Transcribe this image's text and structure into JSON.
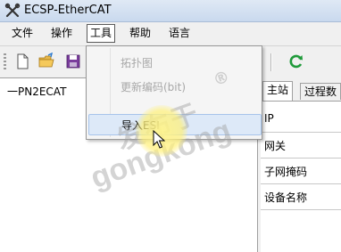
{
  "window": {
    "title": "ECSP-EtherCAT",
    "icon": "tools-icon"
  },
  "menubar": {
    "items": [
      {
        "label": "文件"
      },
      {
        "label": "操作"
      },
      {
        "label": "工具",
        "open": true
      },
      {
        "label": "帮助"
      },
      {
        "label": "语言"
      }
    ]
  },
  "toolbar": {
    "buttons": [
      {
        "icon": "new-file-icon"
      },
      {
        "icon": "open-folder-icon"
      },
      {
        "icon": "save-icon"
      },
      {
        "icon": "refresh-icon"
      }
    ]
  },
  "tools_menu": {
    "items": [
      {
        "label": "拓扑图",
        "enabled": false
      },
      {
        "label": "更新编码(bit)",
        "enabled": false
      },
      {
        "label": "导入ESI",
        "enabled": true,
        "highlighted": true
      }
    ]
  },
  "tree": {
    "root": "一PN2ECAT"
  },
  "right_panel": {
    "tabs": [
      {
        "label": "主站",
        "active": true
      },
      {
        "label": "过程数"
      }
    ],
    "rows": [
      {
        "label": "IP"
      },
      {
        "label": "网关"
      },
      {
        "label": "子网掩码"
      },
      {
        "label": "设备名称"
      }
    ]
  },
  "watermark": {
    "line1": "发布于",
    "line2": "gongkong",
    "mark": "®"
  },
  "colors": {
    "accent": "#dde9f8",
    "disabled_text": "#a8a8a8",
    "cursor_highlight": "#fff08c"
  }
}
